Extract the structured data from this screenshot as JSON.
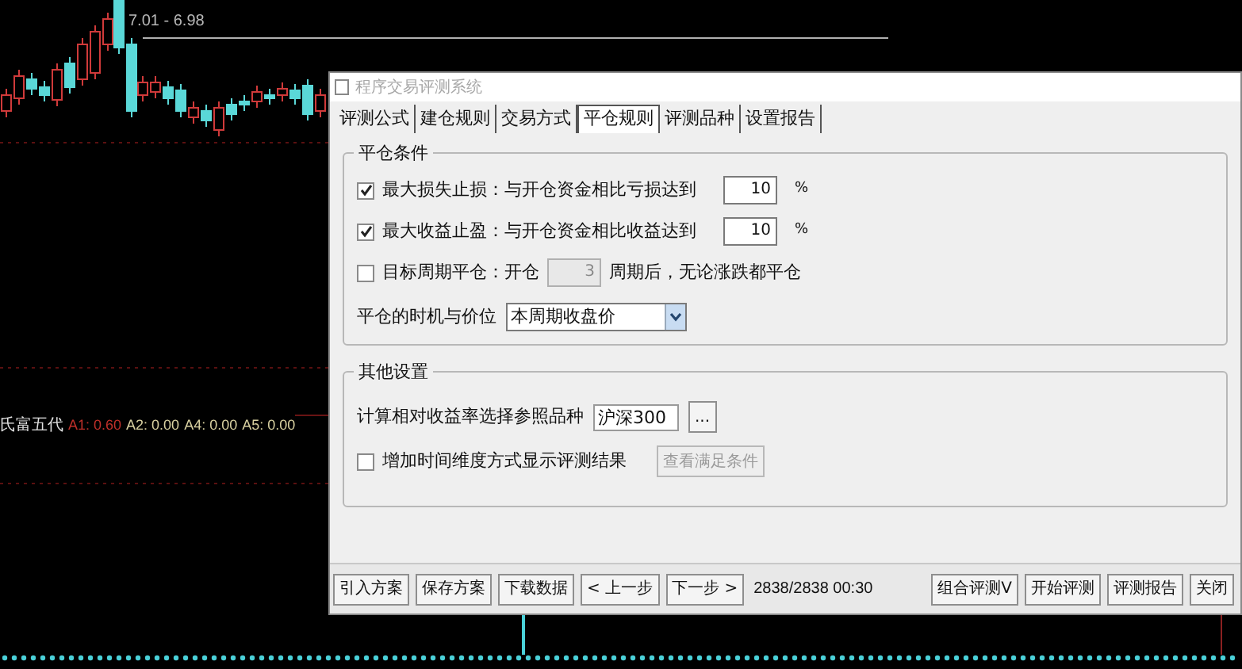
{
  "chart": {
    "price_label": "7.01 - 6.98",
    "indicator": {
      "name": "氏富五代",
      "values": [
        {
          "label": "A1: 0.60",
          "color": "#c0302a"
        },
        {
          "label": "A2: 0.00",
          "color": "#d8d0a0"
        },
        {
          "label": "A4: 0.00",
          "color": "#d8d0a0"
        },
        {
          "label": "A5: 0.00",
          "color": "#d8d0a0"
        }
      ]
    }
  },
  "window": {
    "title": "程序交易评测系统"
  },
  "tabs": [
    {
      "label": "评测公式",
      "selected": false
    },
    {
      "label": "建仓规则",
      "selected": false
    },
    {
      "label": "交易方式",
      "selected": false
    },
    {
      "label": "平仓规则",
      "selected": true
    },
    {
      "label": "评测品种",
      "selected": false
    },
    {
      "label": "设置报告",
      "selected": false
    }
  ],
  "close_conditions": {
    "title": "平仓条件",
    "rows": [
      {
        "checked": true,
        "label": "最大损失止损：与开仓资金相比亏损达到",
        "value": "10",
        "disabled": false,
        "suffix": "%"
      },
      {
        "checked": true,
        "label": "最大收益止盈：与开仓资金相比收益达到",
        "value": "10",
        "disabled": false,
        "suffix": "%"
      },
      {
        "checked": false,
        "label": "目标周期平仓：开仓",
        "value": "3",
        "disabled": true,
        "suffix": "周期后，无论涨跌都平仓"
      }
    ],
    "timing": {
      "label": "平仓的时机与价位",
      "value": "本周期收盘价"
    }
  },
  "other_settings": {
    "title": "其他设置",
    "benchmark": {
      "label": "计算相对收益率选择参照品种",
      "value": "沪深300",
      "button": "..."
    },
    "time_dimension": {
      "checked": false,
      "label": "增加时间维度方式显示评测结果",
      "button": "查看满足条件",
      "button_disabled": true
    }
  },
  "footer": {
    "left_buttons": [
      "引入方案",
      "保存方案",
      "下载数据",
      "< 上一步",
      "下一步 >"
    ],
    "progress": "2838/2838 00:30",
    "right_buttons": [
      "组合评测V",
      "开始评测",
      "评测报告",
      "关闭"
    ]
  }
}
